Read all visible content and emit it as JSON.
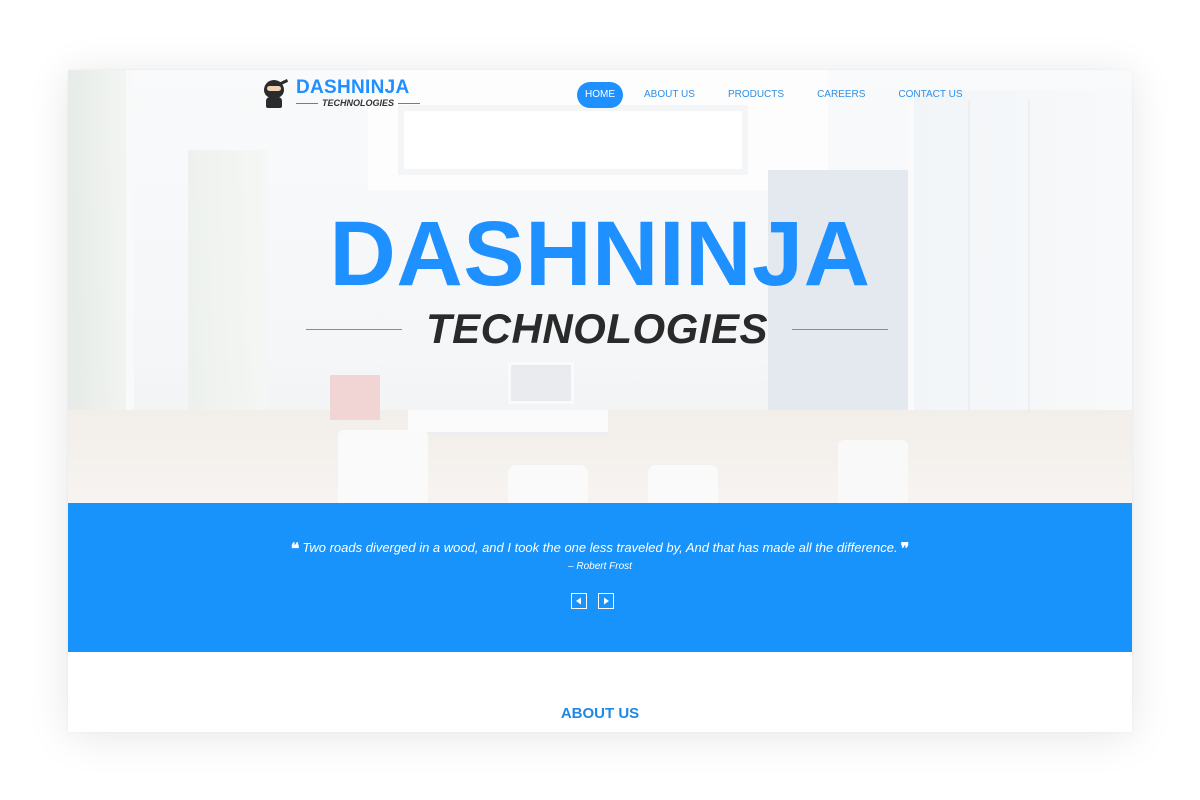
{
  "brand": {
    "name": "DASHNINJA",
    "tagline": "TECHNOLOGIES",
    "logo_icon": "ninja-icon",
    "accent_color": "#1e90ff"
  },
  "nav": {
    "items": [
      {
        "label": "HOME",
        "active": true
      },
      {
        "label": "ABOUT US",
        "active": false
      },
      {
        "label": "PRODUCTS",
        "active": false
      },
      {
        "label": "CAREERS",
        "active": false
      },
      {
        "label": "CONTACT US",
        "active": false
      }
    ]
  },
  "hero": {
    "title": "DASHNINJA",
    "subtitle": "TECHNOLOGIES",
    "background": "office-interior-photo"
  },
  "quote": {
    "open_mark": "❝",
    "text": "Two roads diverged in a wood, and I took the one less traveled by, And that has made all the difference.",
    "close_mark": "❞",
    "author": "– Robert Frost",
    "prev_icon": "triangle-left-icon",
    "next_icon": "triangle-right-icon",
    "band_color": "#1793fb"
  },
  "about": {
    "heading": "ABOUT US"
  }
}
